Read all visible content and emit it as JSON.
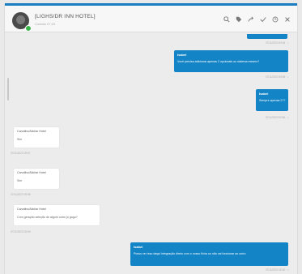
{
  "header": {
    "contact_name": "[LIGHS/DR INN HOTEL]",
    "contact_status": "Contato 07:23"
  },
  "toolbar": {
    "icons": [
      "search-icon",
      "tag-icon",
      "share-icon",
      "check-icon",
      "clock-icon",
      "close-icon"
    ]
  },
  "messages": [
    {
      "direction": "out",
      "time": "07/11/2023 09:54",
      "sender": "Isabel",
      "text": "Você precisa adicionar apenas 2 opcionais ou sistema mesmo?"
    },
    {
      "direction": "out",
      "time": "07/11/2023 09:55",
      "sender": "Isabel",
      "text": "Sempre apenas 2??"
    },
    {
      "direction": "in",
      "time": "07/11/2023 09:56",
      "sender": "Carvalho/Alichar Hotel",
      "text": "Sim"
    },
    {
      "direction": "in",
      "time": "07/11/2023 09:57",
      "sender": "Carvalho/Alichar Hotel",
      "text": "Sim"
    },
    {
      "direction": "in",
      "time": "07/11/2023 09:58",
      "sender": "Carvalho/Alichar Hotel",
      "text": "Com geração seleção de algum outro jo gogo?"
    },
    {
      "direction": "out",
      "time": "07/11/2023 09:59",
      "sender": "Isabel",
      "text": "Posso ver isso daqui integração direto com o nosso ficha ou não vai funcionar ao outro"
    }
  ],
  "timestamps": {
    "top": "07/11/2023 09:54",
    "m1": "07/11/2023 09:55",
    "m2": "07/11/2023 09:56",
    "m3": "07/11/2023 09:57",
    "m4": "07/11/2023 09:58",
    "m5": "07/11/2023 09:59",
    "m6": "07/11/2023 10:00"
  }
}
